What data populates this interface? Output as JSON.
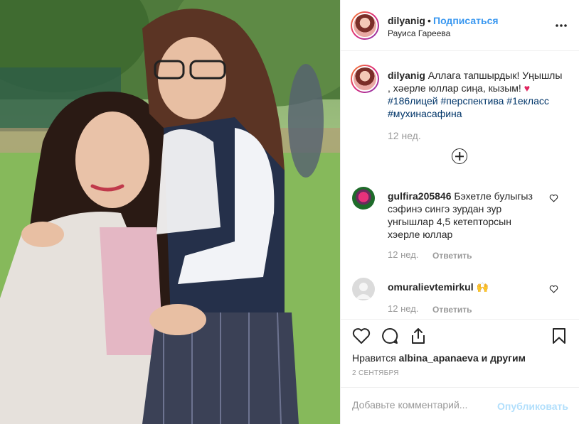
{
  "post": {
    "username": "dilyanig",
    "separator": "•",
    "follow_label": "Подписаться",
    "location": "Рауиса Гареева"
  },
  "caption": {
    "username": "dilyanig",
    "text": "Аллага тапшырдык! Уңышлы , хәерле юллар сиңа, кызым!",
    "emoji": "♥",
    "hashtags": [
      "#186лицей",
      "#перспектива",
      "#1екласс",
      "#мухинасафина"
    ],
    "time": "12 нед."
  },
  "comments": [
    {
      "username": "gulfira205846",
      "text": "Бэхетле булыгыз сэфинэ сингэ зурдан зур унгышлар 4,5 кетепторсын хэерле юллар",
      "time": "12 нед.",
      "reply_label": "Ответить"
    },
    {
      "username": "omuralievtemirkul",
      "text": "🙌",
      "time": "12 нед.",
      "reply_label": "Ответить"
    }
  ],
  "actions": {
    "icons": [
      "heart-icon",
      "comment-icon",
      "share-icon",
      "bookmark-icon"
    ],
    "likes_prefix": "Нравится",
    "likes_user": "albina_apanaeva",
    "likes_suffix": "и другим",
    "date": "2 СЕНТЯБРЯ"
  },
  "add_comment": {
    "placeholder": "Добавьте комментарий...",
    "publish_label": "Опубликовать"
  },
  "colors": {
    "link_blue": "#3897f0",
    "hashtag": "#003569",
    "muted": "#999999",
    "publish_disabled": "#b2dffc"
  }
}
